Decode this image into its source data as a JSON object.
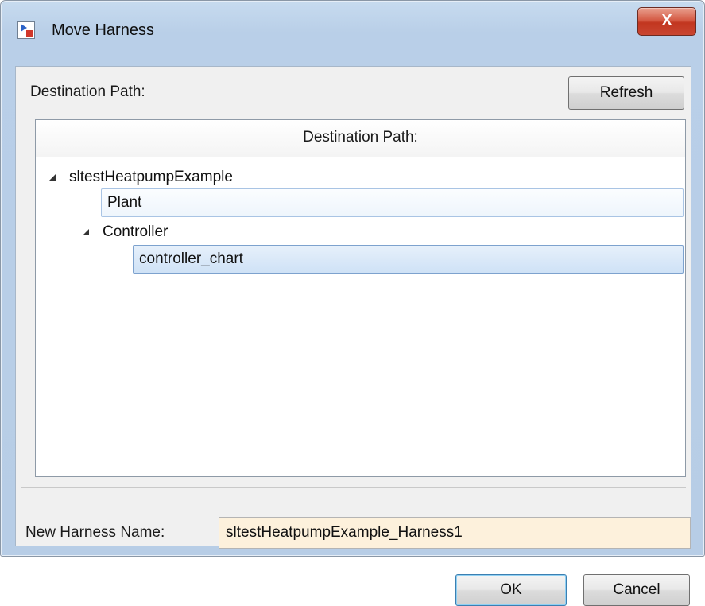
{
  "window": {
    "title": "Move Harness",
    "close_label": "X"
  },
  "destination": {
    "label": "Destination Path:",
    "refresh_label": "Refresh",
    "column_header": "Destination Path:"
  },
  "tree": {
    "root": "sltestHeatpumpExample",
    "plant": "Plant",
    "controller": "Controller",
    "controller_chart": "controller_chart",
    "selected": "controller_chart"
  },
  "harness": {
    "name_label": "New Harness Name:",
    "name_value": "sltestHeatpumpExample_Harness1"
  },
  "buttons": {
    "ok_label": "OK",
    "cancel_label": "Cancel"
  },
  "icons": {
    "app": "simulink-model-icon",
    "expanded": "expanded-triangle-icon"
  }
}
